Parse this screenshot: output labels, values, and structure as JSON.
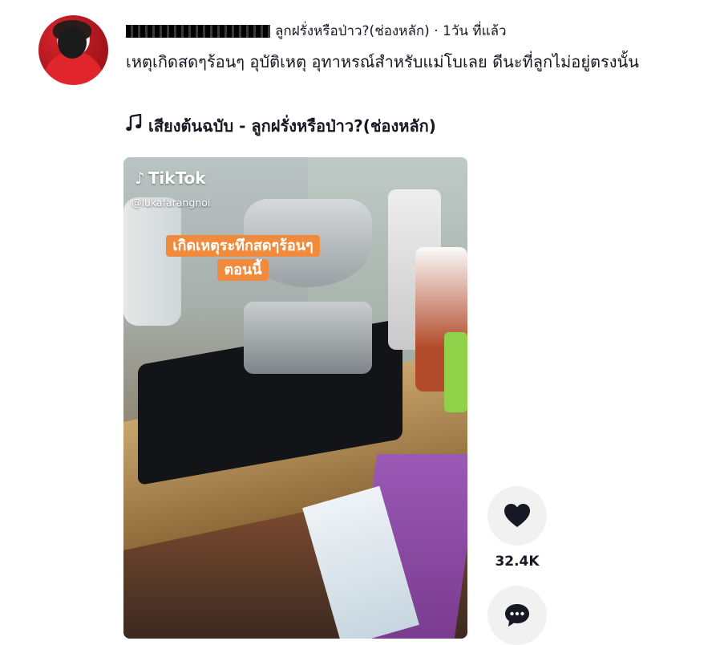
{
  "author": {
    "username": "lukafarangnoi",
    "channel_name": "ลูกฝรั่งหรือป่าว?(ช่องหลัก)",
    "separator": " · ",
    "posted_time": "1วัน ที่แล้ว"
  },
  "caption": "เหตุเกิดสดๆร้อนๆ อุบัติเหตุ อุทาหรณ์สำหรับแม่โบเลย ดีนะที่ลูกไม่อยู่ตรงนั้น",
  "music": {
    "icon": "music-note-icon",
    "label": "เสียงต้นฉบับ - ลูกฝรั่งหรือป่าว?(ช่องหลัก)"
  },
  "video": {
    "watermark_brand": "TikTok",
    "watermark_handle": "@lukafarangnoi",
    "overlay_line1": "เกิดเหตุระทึกสดๆร้อนๆ",
    "overlay_line2": "ตอนนี้",
    "overlay_color": "#f08a3c"
  },
  "actions": {
    "like_icon": "heart-icon",
    "like_count": "32.4K",
    "comment_icon": "comment-icon"
  },
  "colors": {
    "text": "#161823",
    "button_bg": "#f1f1f2"
  }
}
